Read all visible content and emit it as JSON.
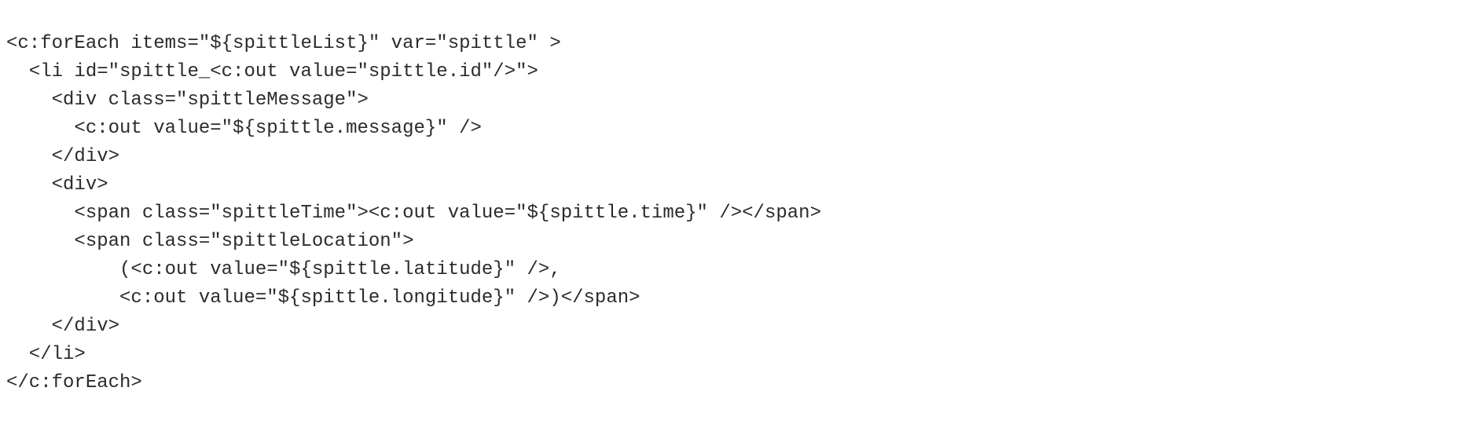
{
  "code": {
    "lines": [
      "<c:forEach items=\"${spittleList}\" var=\"spittle\" >",
      "  <li id=\"spittle_<c:out value=\"spittle.id\"/>\">",
      "    <div class=\"spittleMessage\">",
      "      <c:out value=\"${spittle.message}\" />",
      "    </div>",
      "    <div>",
      "      <span class=\"spittleTime\"><c:out value=\"${spittle.time}\" /></span>",
      "      <span class=\"spittleLocation\">",
      "          (<c:out value=\"${spittle.latitude}\" />,",
      "          <c:out value=\"${spittle.longitude}\" />)</span>",
      "    </div>",
      "  </li>",
      "</c:forEach>"
    ]
  }
}
